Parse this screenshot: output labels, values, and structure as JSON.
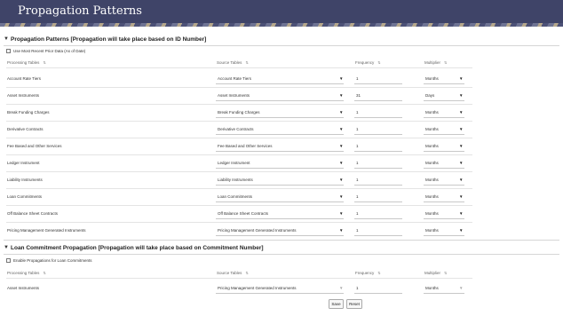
{
  "page": {
    "title": "Propagation Patterns"
  },
  "section1": {
    "title": "Propagation Patterns [Propagation will take place based on ID Number]",
    "checkbox_label": "Use Most Recent Prior Data (As of Date)",
    "columns": {
      "processing": "Processing Tables",
      "source": "Source Tables",
      "frequency": "Frequency",
      "multiplier": "Multiplier"
    },
    "rows": [
      {
        "processing": "Account Rate Tiers",
        "source": "Account Rate Tiers",
        "frequency": "1",
        "multiplier": "Months"
      },
      {
        "processing": "Asset Instruments",
        "source": "Asset Instruments",
        "frequency": "31",
        "multiplier": "Days"
      },
      {
        "processing": "Break Funding Charges",
        "source": "Break Funding Charges",
        "frequency": "1",
        "multiplier": "Months"
      },
      {
        "processing": "Derivative Contracts",
        "source": "Derivative Contracts",
        "frequency": "1",
        "multiplier": "Months"
      },
      {
        "processing": "Fee Based and Other Services",
        "source": "Fee Based and Other Services",
        "frequency": "1",
        "multiplier": "Months"
      },
      {
        "processing": "Ledger Instrument",
        "source": "Ledger Instrument",
        "frequency": "1",
        "multiplier": "Months"
      },
      {
        "processing": "Liability Instruments",
        "source": "Liability Instruments",
        "frequency": "1",
        "multiplier": "Months"
      },
      {
        "processing": "Loan Commitments",
        "source": "Loan Commitments",
        "frequency": "1",
        "multiplier": "Months"
      },
      {
        "processing": "Off Balance Sheet Contracts",
        "source": "Off Balance Sheet Contracts",
        "frequency": "1",
        "multiplier": "Months"
      },
      {
        "processing": "Pricing Management Generated Instruments",
        "source": "Pricing Management Generated Instruments",
        "frequency": "1",
        "multiplier": "Months"
      }
    ]
  },
  "section2": {
    "title": "Loan Commitment Propagation [Propagation will take place based on Commitment Number]",
    "checkbox_label": "Enable Propagations for Loan Commitments",
    "columns": {
      "processing": "Processing Tables",
      "source": "Source Tables",
      "frequency": "Frequency",
      "multiplier": "Multiplier"
    },
    "rows": [
      {
        "processing": "Asset Instruments",
        "source": "Pricing Management Generated Instruments",
        "frequency": "1",
        "multiplier": "Months"
      }
    ]
  },
  "buttons": {
    "save": "Save",
    "reset": "Reset"
  },
  "icons": {
    "chevron": "chevron-down-icon",
    "sort": "sort-icon",
    "dropdown": "caret-down-icon"
  }
}
